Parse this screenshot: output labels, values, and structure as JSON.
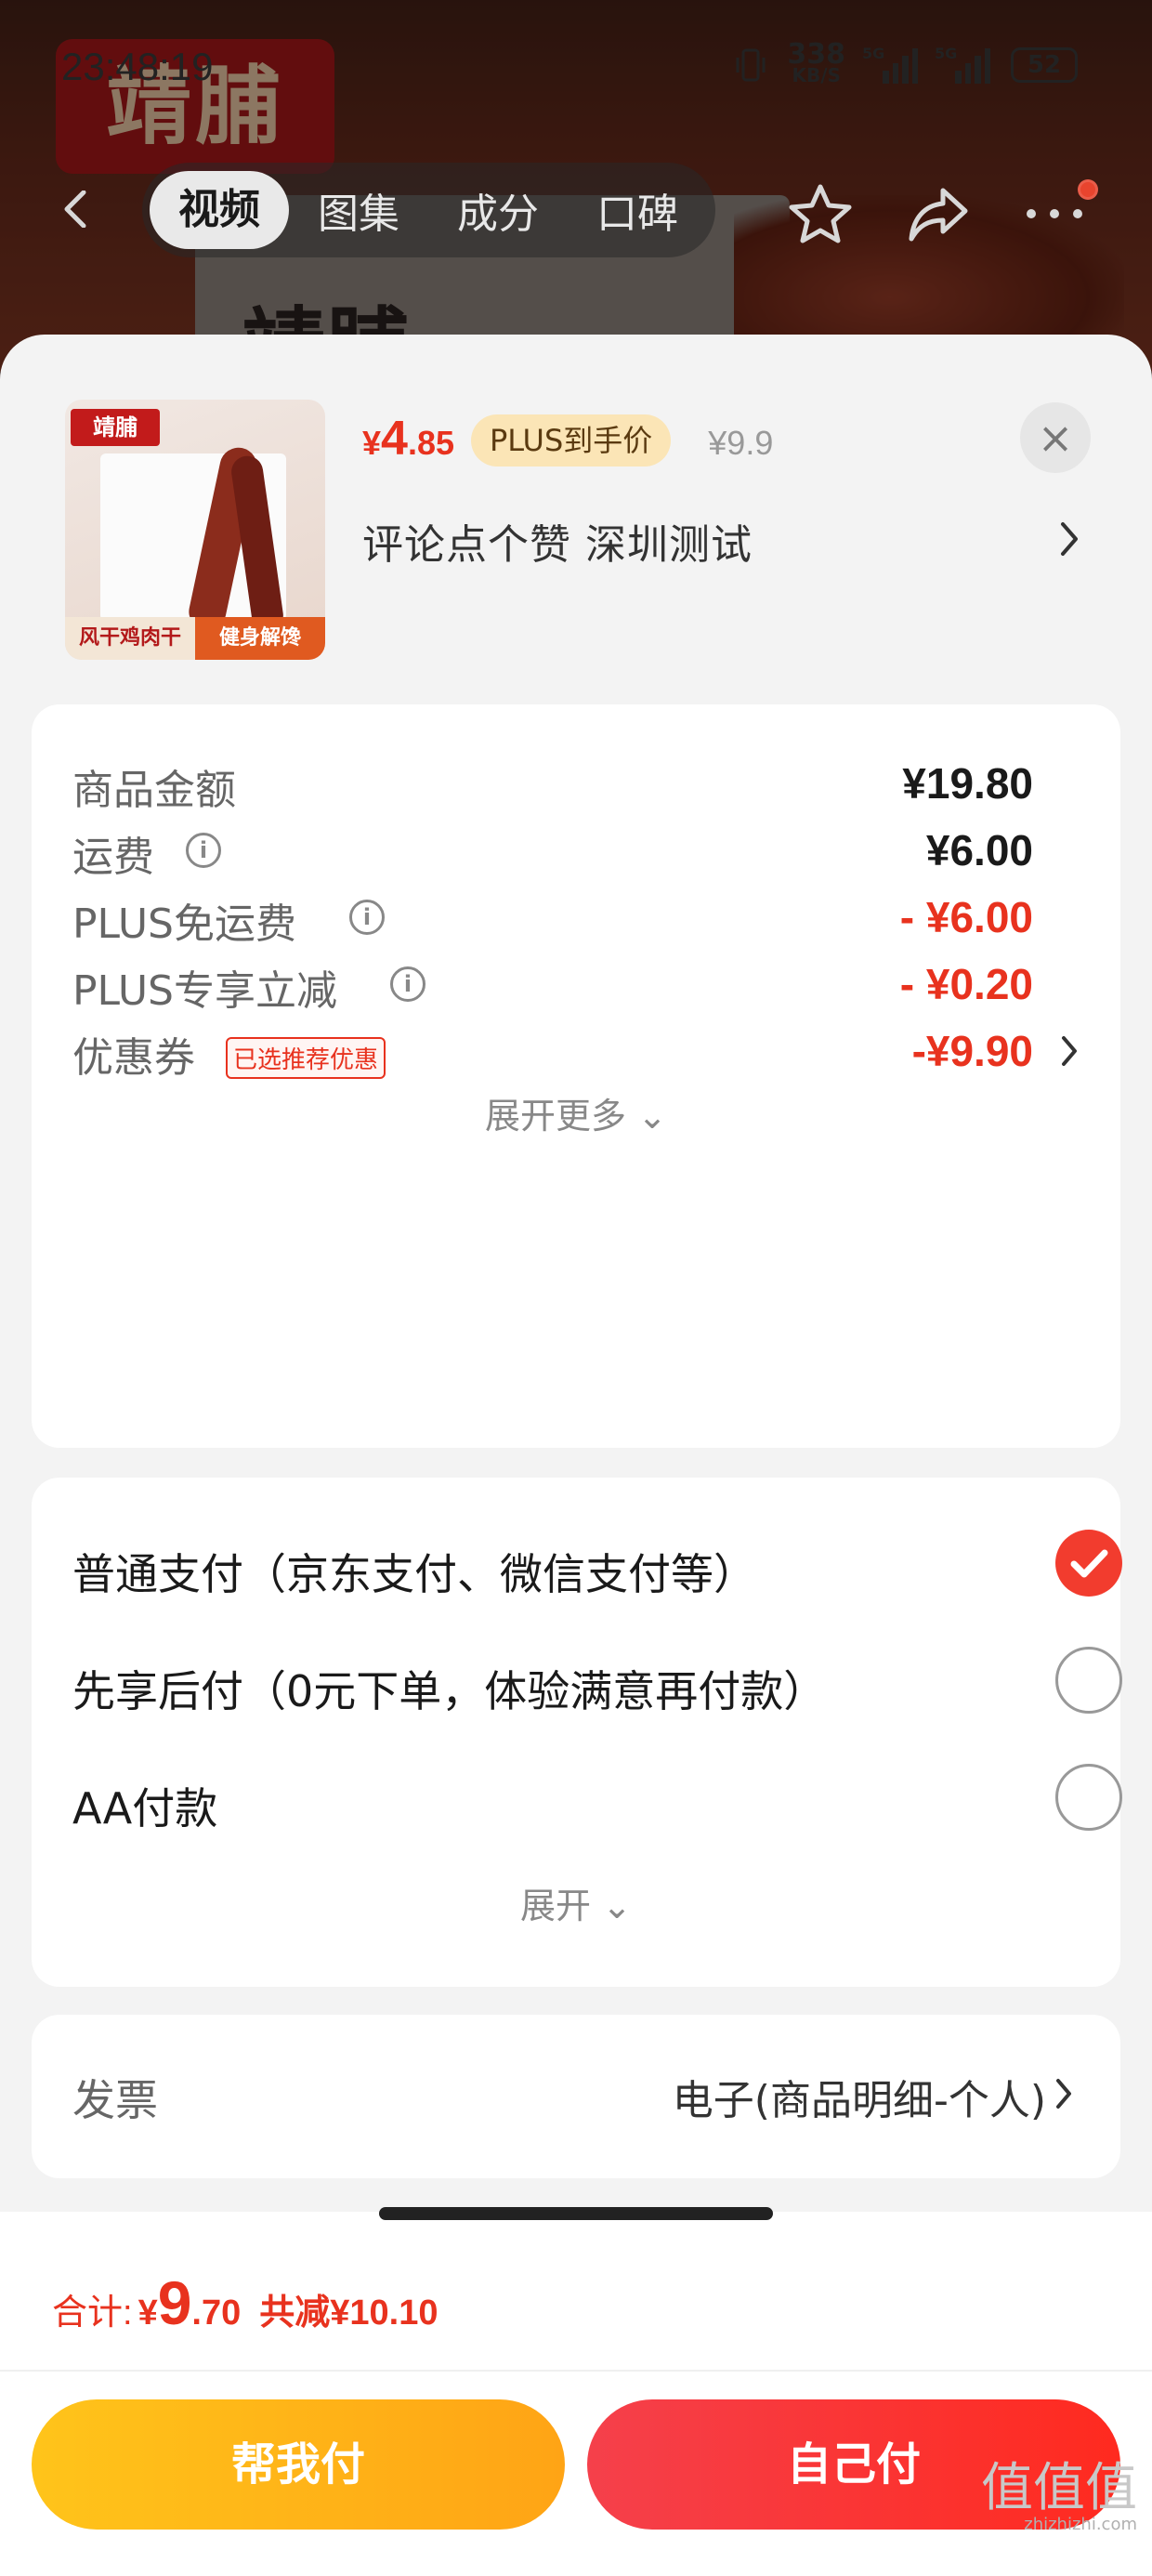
{
  "status_bar": {
    "time": "23:48:19",
    "speed_value": "338",
    "speed_unit": "KB/S",
    "net1": "5G",
    "net2": "5G",
    "battery": "52"
  },
  "background": {
    "brand_logo": "靖脯",
    "bag_text": "靖脯"
  },
  "top_nav": {
    "tabs": [
      {
        "label": "视频",
        "active": true
      },
      {
        "label": "图集"
      },
      {
        "label": "成分"
      },
      {
        "label": "口碑"
      }
    ]
  },
  "product": {
    "thumb_logo": "靖脯",
    "thumb_band_left": "风干鸡肉干",
    "thumb_band_right": "健身解馋",
    "price_symbol": "¥",
    "price_int": "4",
    "price_dec": ".85",
    "plus_tag": "PLUS到手价",
    "original_price": "¥9.9",
    "spec": "评论点个赞  深圳测试",
    "close_icon": "×"
  },
  "amounts": {
    "rows": [
      {
        "label": "商品金额",
        "value": "¥19.80"
      },
      {
        "label": "运费",
        "value": "¥6.00"
      },
      {
        "label": "PLUS免运费",
        "value": "- ¥6.00"
      },
      {
        "label": "PLUS专享立减",
        "value": "- ¥0.20"
      },
      {
        "label": "优惠券",
        "tag": "已选推荐优惠",
        "value": "-¥9.90"
      }
    ],
    "expand_more": "展开更多 ⌄"
  },
  "payment": {
    "options": [
      {
        "label": "普通支付（京东支付、微信支付等）",
        "selected": true
      },
      {
        "label": "先享后付（0元下单，体验满意再付款）",
        "selected": false
      },
      {
        "label": "AA付款",
        "selected": false
      }
    ],
    "expand": "展开 ⌄"
  },
  "invoice": {
    "label": "发票",
    "value": "电子(商品明细-个人)"
  },
  "footer": {
    "total_label": "合计:",
    "total_yen": "¥",
    "total_int": "9",
    "total_dec": ".70",
    "total_save": "共减¥10.10",
    "help_pay": "帮我付",
    "self_pay": "自己付"
  },
  "watermark": {
    "main": "值值值",
    "sub": "zhizhizhi.com"
  },
  "colors": {
    "accent_red": "#e8321e",
    "plus_gold": "#fbe5b6",
    "button_yellow": "#ffb419",
    "button_red": "#f5333a"
  },
  "icons": {
    "back": "back-arrow-icon",
    "favorite": "star-icon",
    "share": "share-icon",
    "more": "more-dots-icon",
    "info": "info-icon",
    "chevron": "chevron-right-icon",
    "check": "check-icon"
  }
}
